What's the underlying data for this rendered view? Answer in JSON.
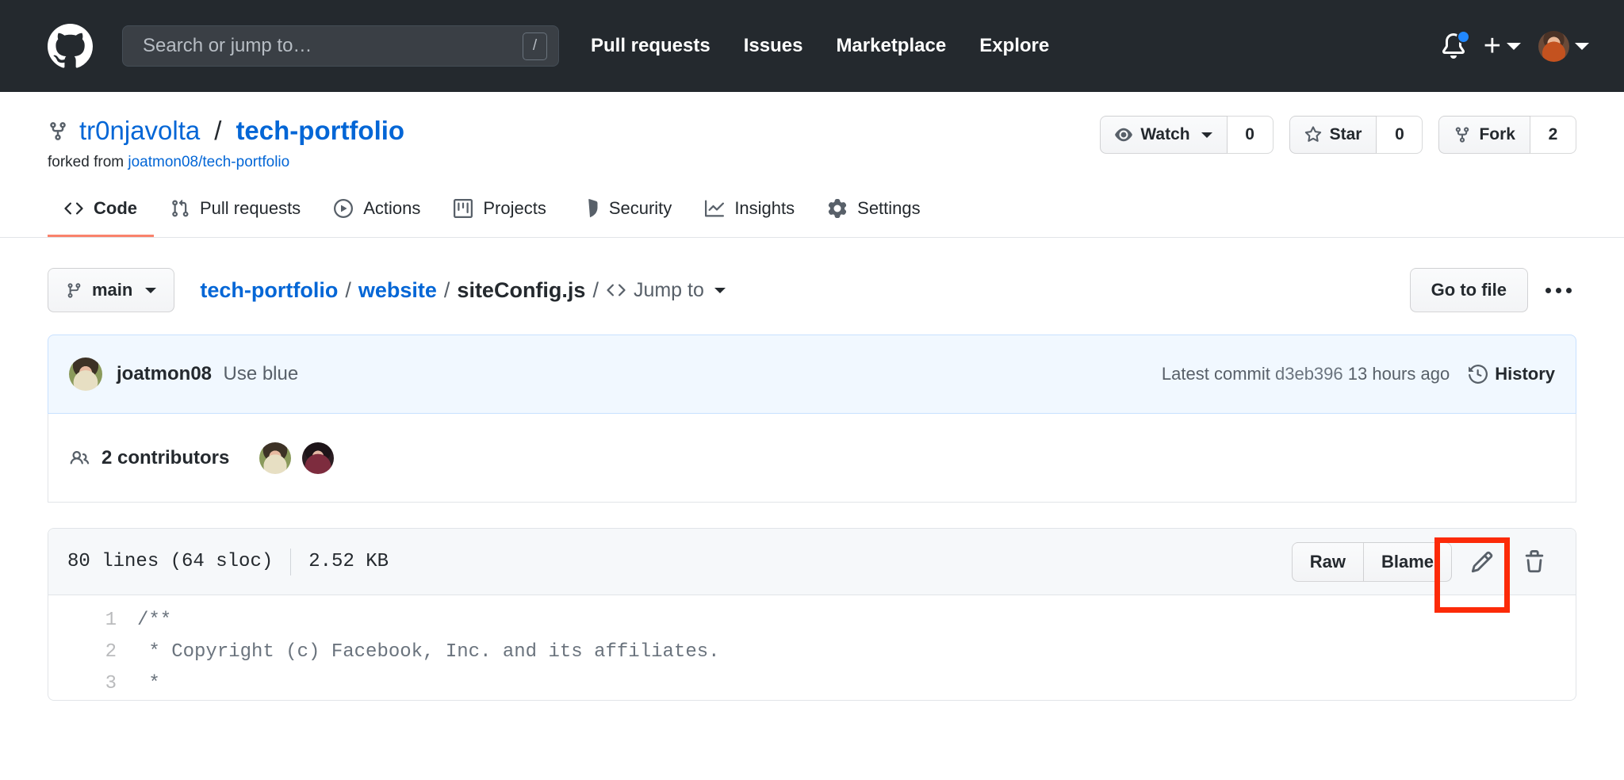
{
  "header": {
    "logo_icon": "github-mark-icon",
    "search": {
      "placeholder": "Search or jump to…",
      "value": "",
      "shortcut": "/"
    },
    "nav": [
      {
        "label": "Pull requests"
      },
      {
        "label": "Issues"
      },
      {
        "label": "Marketplace"
      },
      {
        "label": "Explore"
      }
    ],
    "notifications_icon": "bell-icon",
    "has_unread": true,
    "create_new_icon": "plus-icon",
    "avatar_icon": "user-avatar"
  },
  "repo": {
    "owner": "tr0njavolta",
    "separator": "/",
    "name": "tech-portfolio",
    "fork_icon": "repo-forked-icon",
    "forked_from_label": "forked from",
    "forked_from_repo": "joatmon08/tech-portfolio",
    "actions": [
      {
        "label": "Watch",
        "count": "0",
        "icon": "eye-icon",
        "has_caret": true
      },
      {
        "label": "Star",
        "count": "0",
        "icon": "star-icon",
        "has_caret": false
      },
      {
        "label": "Fork",
        "count": "2",
        "icon": "repo-forked-icon",
        "has_caret": false
      }
    ],
    "tabs": [
      {
        "label": "Code",
        "icon": "code-icon",
        "selected": true
      },
      {
        "label": "Pull requests",
        "icon": "git-pull-request-icon",
        "selected": false
      },
      {
        "label": "Actions",
        "icon": "play-icon",
        "selected": false
      },
      {
        "label": "Projects",
        "icon": "project-board-icon",
        "selected": false
      },
      {
        "label": "Security",
        "icon": "shield-alert-icon",
        "selected": false
      },
      {
        "label": "Insights",
        "icon": "graph-icon",
        "selected": false
      },
      {
        "label": "Settings",
        "icon": "gear-icon",
        "selected": false
      }
    ]
  },
  "file_nav": {
    "branch": "main",
    "branch_icon": "git-branch-icon",
    "breadcrumb": [
      {
        "label": "tech-portfolio",
        "link": true
      },
      {
        "label": "website",
        "link": true
      },
      {
        "label": "siteConfig.js",
        "link": false
      }
    ],
    "jump_to_label": "Jump to",
    "jump_to_icon": "code-icon",
    "go_to_file_label": "Go to file",
    "kebab_icon": "kebab-horizontal-icon"
  },
  "commit_bar": {
    "author": "joatmon08",
    "message": "Use blue",
    "latest_commit_label": "Latest commit",
    "sha": "d3eb396",
    "time_ago": "13 hours ago",
    "history_label": "History",
    "history_icon": "history-icon",
    "avatar_icon": "commit-author-avatar"
  },
  "contributors": {
    "count_label": "2 contributors",
    "icon": "people-icon",
    "avatars": [
      "contributor-avatar-1",
      "contributor-avatar-2"
    ]
  },
  "file_header": {
    "lines": "80 lines (64 sloc)",
    "size": "2.52 KB",
    "raw_label": "Raw",
    "blame_label": "Blame",
    "edit_icon": "pencil-icon",
    "delete_icon": "trash-icon",
    "highlight_color": "#fc2a08",
    "highlighted_element": "edit-file-button"
  },
  "code": {
    "lines": [
      {
        "number": "1",
        "text": "/**"
      },
      {
        "number": "2",
        "text": " * Copyright (c) Facebook, Inc. and its affiliates."
      },
      {
        "number": "3",
        "text": " *"
      }
    ]
  },
  "colors": {
    "header_bg": "#24292e",
    "link_blue": "#0366d6",
    "active_tab_underline": "#f9826c",
    "commit_bar_bg": "#f1f8ff",
    "commit_bar_border": "#c8e1ff",
    "border_gray": "#e1e4e8"
  }
}
